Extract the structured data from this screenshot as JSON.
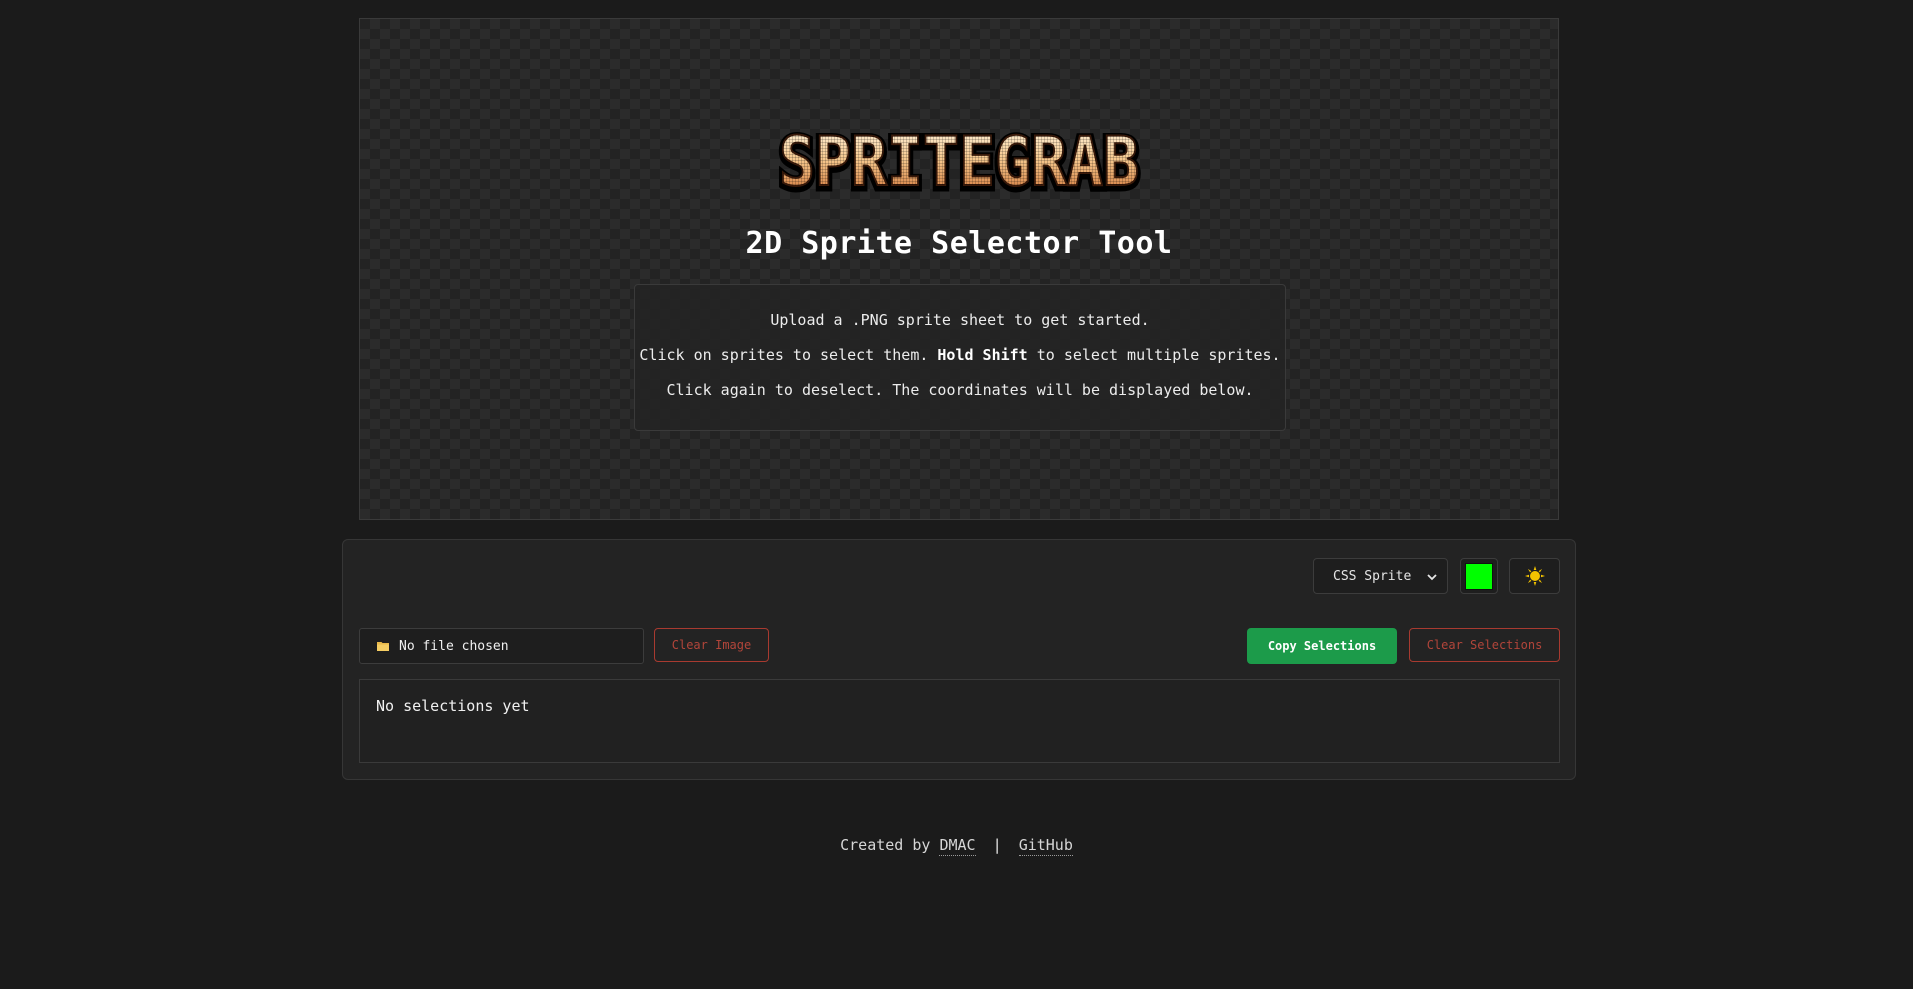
{
  "hero": {
    "logo_text": "SPRITEGRAB",
    "title": "2D Sprite Selector Tool",
    "instructions": {
      "line1": "Upload a .PNG sprite sheet to get started.",
      "line2_pre": "Click on sprites to select them. ",
      "line2_bold": "Hold Shift",
      "line2_post": " to select multiple sprites.",
      "line3": "Click again to deselect. The coordinates will be displayed below."
    }
  },
  "controls": {
    "format_select": {
      "selected": "CSS Sprite"
    },
    "highlight_color": "#00ff00",
    "theme_icon": "sun-icon",
    "file_input": {
      "icon": "folder-icon",
      "label": "No file chosen"
    },
    "clear_image_label": "Clear Image",
    "copy_selections_label": "Copy Selections",
    "clear_selections_label": "Clear Selections",
    "output_text": "No selections yet"
  },
  "footer": {
    "prefix": "Created by",
    "author_link": "DMAC",
    "separator": "|",
    "github_link": "GitHub"
  },
  "colors": {
    "background": "#1b1b1b",
    "accent_green": "#1c9b4a",
    "danger_red": "#b2453a"
  }
}
